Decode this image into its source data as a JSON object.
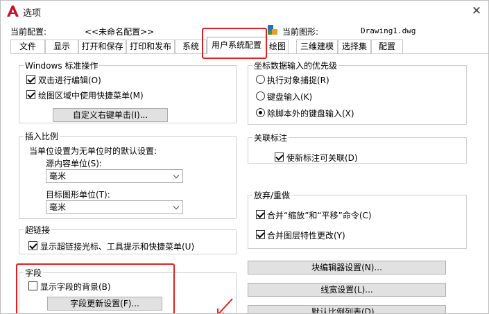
{
  "window": {
    "title": "选项",
    "close_symbol": "✕"
  },
  "profile": {
    "current_profile_label": "当前配置:",
    "current_profile_value": "<<未命名配置>>",
    "current_drawing_label": "当前图形:",
    "current_drawing_value": "Drawing1.dwg"
  },
  "tabs": [
    {
      "label": "文件"
    },
    {
      "label": "显示"
    },
    {
      "label": "打开和保存"
    },
    {
      "label": "打印和发布"
    },
    {
      "label": "系统"
    },
    {
      "label": "用户系统配置"
    },
    {
      "label": "绘图"
    },
    {
      "label": "三维建模"
    },
    {
      "label": "选择集"
    },
    {
      "label": "配置"
    }
  ],
  "windows_ops": {
    "title": "Windows 标准操作",
    "double_click_edit": "双击进行编辑(O)",
    "shortcut_menu": "绘图区域中使用快捷菜单(M)",
    "customize_right_click": "自定义右键单击(I)..."
  },
  "insert_scale": {
    "title": "插入比例",
    "desc": "当单位设置为无单位时的默认设置:",
    "source_label": "源内容单位(S):",
    "source_value": "毫米",
    "target_label": "目标图形单位(T):",
    "target_value": "毫米"
  },
  "hyperlink": {
    "title": "超链接",
    "show_cursor": "显示超链接光标、工具提示和快捷菜单(U)"
  },
  "fields": {
    "title": "字段",
    "show_background": "显示字段的背景(B)",
    "update_settings": "字段更新设置(F)..."
  },
  "coord_priority": {
    "title": "坐标数据输入的优先级",
    "options": [
      "执行对象捕捉(R)",
      "键盘输入(K)",
      "除脚本外的键盘输入(X)"
    ],
    "selected": "除脚本外的键盘输入(X)"
  },
  "assoc_dim": {
    "title": "关联标注",
    "new_assoc": "使新标注可关联(D)"
  },
  "undo_redo": {
    "title": "放弃/重做",
    "combine_zoom_pan": "合并“缩放”和“平移”命令(C)",
    "combine_layer": "合并图层特性更改(Y)"
  },
  "right_buttons": {
    "block_editor": "块编辑器设置(N)...",
    "lineweight": "线宽设置(L)...",
    "default_scale_list": "默认比例列表(D)..."
  },
  "colors": {
    "highlight": "#e02020",
    "logo": "#c8102e"
  }
}
